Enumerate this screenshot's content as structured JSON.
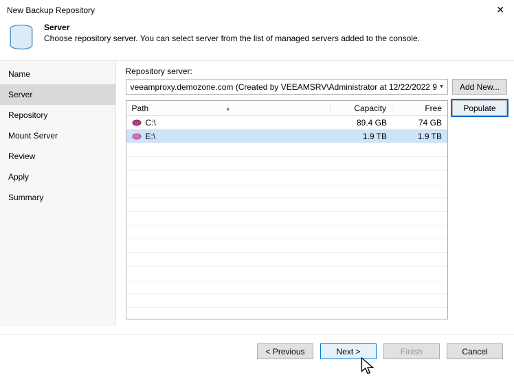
{
  "window": {
    "title": "New Backup Repository"
  },
  "header": {
    "title": "Server",
    "subtitle": "Choose repository server. You can select server from the list of managed servers added to the console."
  },
  "sidebar": {
    "items": [
      {
        "label": "Name"
      },
      {
        "label": "Server"
      },
      {
        "label": "Repository"
      },
      {
        "label": "Mount Server"
      },
      {
        "label": "Review"
      },
      {
        "label": "Apply"
      },
      {
        "label": "Summary"
      }
    ],
    "selected_index": 1
  },
  "content": {
    "repo_server_label": "Repository server:",
    "combo_value": "veeamproxy.demozone.com (Created by VEEAMSRV\\Administrator at 12/22/2022 9",
    "add_new_label": "Add New...",
    "populate_label": "Populate",
    "columns": {
      "path": "Path",
      "capacity": "Capacity",
      "free": "Free"
    },
    "rows": [
      {
        "path": "C:\\",
        "capacity": "89.4 GB",
        "free": "74 GB",
        "color": "#b93a8f"
      },
      {
        "path": "E:\\",
        "capacity": "1.9 TB",
        "free": "1.9 TB",
        "color": "#d66fb8"
      }
    ],
    "selected_row_index": 1
  },
  "footer": {
    "previous": "< Previous",
    "next": "Next >",
    "finish": "Finish",
    "cancel": "Cancel"
  }
}
